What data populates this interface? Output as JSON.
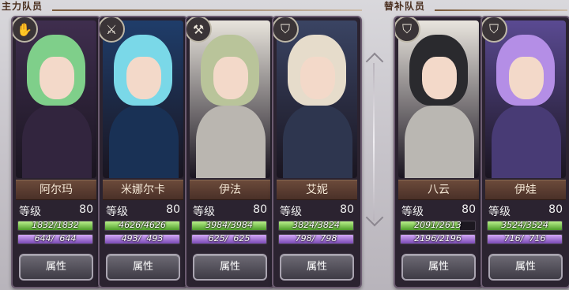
{
  "sections": {
    "main_team_label": "主力队员",
    "reserve_team_label": "替补队员"
  },
  "level_label": "等级",
  "attr_button_label": "属性",
  "cards": [
    {
      "name": "阿尔玛",
      "level": "80",
      "hp_text": "1832/1832",
      "hp_fraction": 1.0,
      "mp_text": "644/  644",
      "mp_fraction": 1.0,
      "class_icon": "hand-icon",
      "theme": "#3f2e4e",
      "hair": "#7fcf8a"
    },
    {
      "name": "米娜尔卡",
      "level": "80",
      "hp_text": "4626/4626",
      "hp_fraction": 1.0,
      "mp_text": "493/  493",
      "mp_fraction": 1.0,
      "class_icon": "sword-icon",
      "theme": "#1f3d6a",
      "hair": "#7ad8e8"
    },
    {
      "name": "伊法",
      "level": "80",
      "hp_text": "3984/3984",
      "hp_fraction": 1.0,
      "mp_text": "625/  625",
      "mp_fraction": 1.0,
      "class_icon": "hammer-icon",
      "theme": "#e8e4dc",
      "hair": "#b9c49a"
    },
    {
      "name": "艾妮",
      "level": "80",
      "hp_text": "3824/3824",
      "hp_fraction": 1.0,
      "mp_text": "798/  798",
      "mp_fraction": 1.0,
      "class_icon": "shield-icon",
      "theme": "#3a4463",
      "hair": "#e6dccb"
    },
    {
      "name": "八云",
      "level": "80",
      "hp_text": "2091/2613",
      "hp_fraction": 0.8,
      "mp_text": "2196/2196",
      "mp_fraction": 1.0,
      "class_icon": "shield-icon",
      "theme": "#e9e5de",
      "hair": "#2a2a2e"
    },
    {
      "name": "伊娃",
      "level": "80",
      "hp_text": "3524/3524",
      "hp_fraction": 1.0,
      "mp_text": "716/  716",
      "mp_fraction": 1.0,
      "class_icon": "shield-icon",
      "theme": "#5a4a92",
      "hair": "#b48ee6"
    }
  ]
}
